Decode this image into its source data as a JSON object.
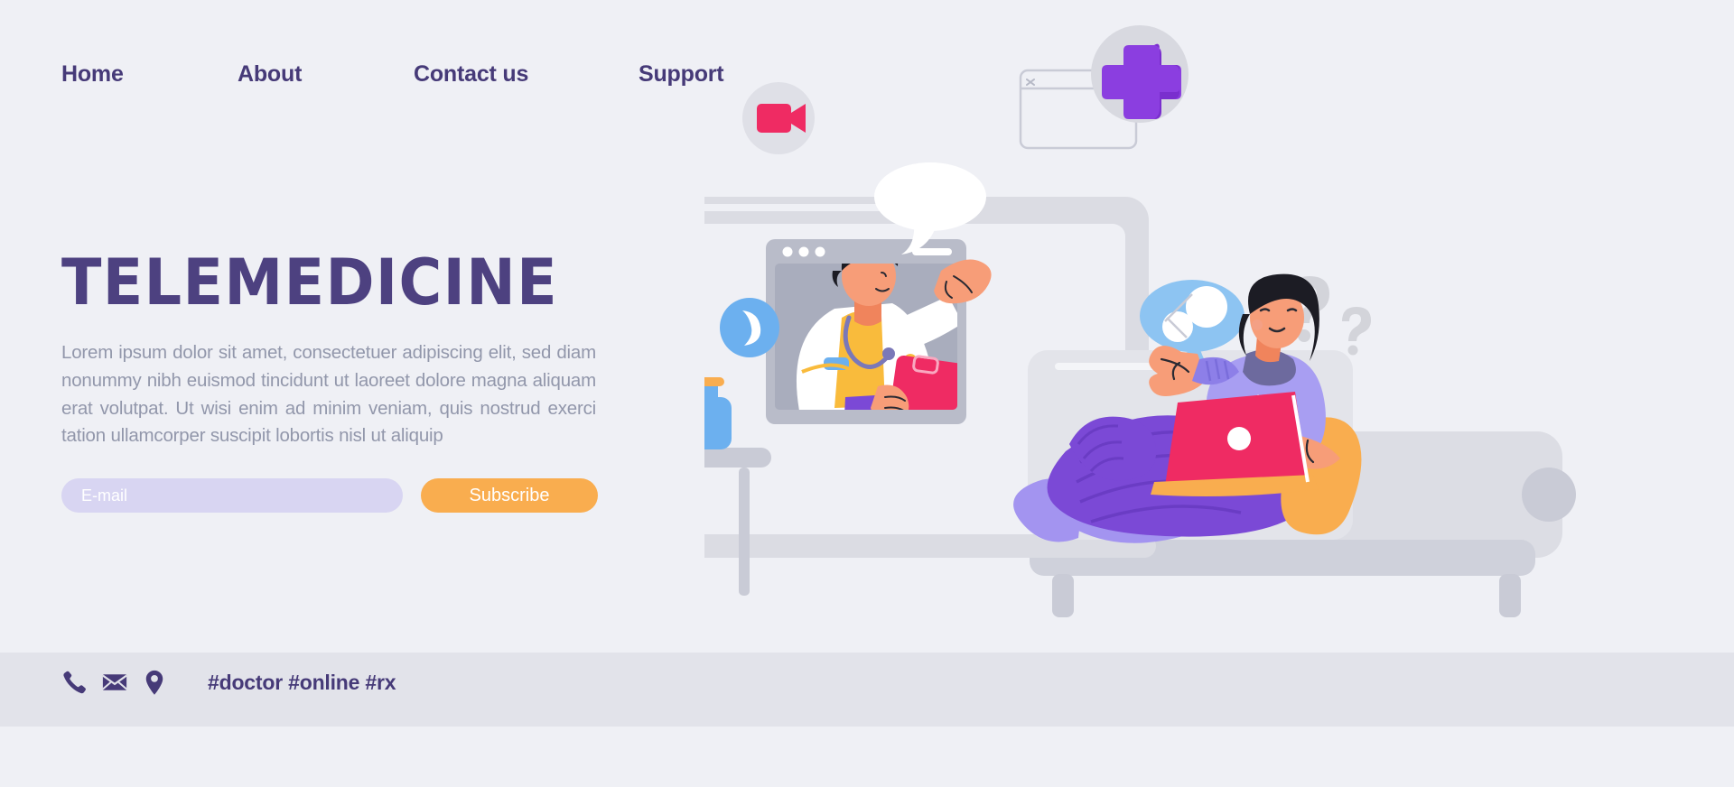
{
  "nav": {
    "items": [
      {
        "label": "Home",
        "name": "nav-item-home"
      },
      {
        "label": "About",
        "name": "nav-item-about"
      },
      {
        "label": "Contact us",
        "name": "nav-item-contact-us"
      },
      {
        "label": "Support",
        "name": "nav-item-support"
      }
    ]
  },
  "hero": {
    "title": "TELEMEDICINE",
    "description": "Lorem ipsum dolor sit amet, consectetuer adipiscing elit, sed diam nonummy nibh euismod tincidunt ut laoreet dolore magna aliquam erat volutpat. Ut wisi enim ad minim veniam, quis nostrud exerci tation ullamcorper suscipit lobortis nisl ut aliquip"
  },
  "form": {
    "email_placeholder": "E-mail",
    "email_value": "",
    "subscribe_label": "Subscribe"
  },
  "footer": {
    "icons": [
      {
        "name": "phone-icon",
        "label": "phone"
      },
      {
        "name": "envelope-icon",
        "label": "email"
      },
      {
        "name": "location-pin-icon",
        "label": "location"
      }
    ],
    "tags": "#doctor #online #rx"
  },
  "illustration": {
    "description": "Telemedicine scene: doctor on video call in monitor, patient with laptop on sofa",
    "badges": [
      {
        "name": "video-camera-badge-icon",
        "label": "video camera"
      },
      {
        "name": "medical-cross-badge-icon",
        "label": "medical cross"
      },
      {
        "name": "phone-call-badge-icon",
        "label": "phone call"
      },
      {
        "name": "browser-window-outline-icon",
        "label": "browser window"
      },
      {
        "name": "pill-speech-bubble-icon",
        "label": "pills speech bubble"
      },
      {
        "name": "question-marks-icon",
        "label": "question marks"
      },
      {
        "name": "doctor-speech-bubble-icon",
        "label": "speech bubble"
      }
    ]
  },
  "colors": {
    "background": "#eff0f5",
    "footer_background": "#e2e3ea",
    "brand_purple": "#4d4180",
    "nav_purple": "#463a78",
    "body_gray": "#9297ab",
    "input_lavender": "#d8d5f2",
    "accent_orange": "#f9ad4f",
    "accent_pink": "#ef2b63",
    "accent_blue": "#6cb0ef",
    "cross_purple": "#8b3ee0",
    "skin": "#f79d78",
    "device_gray": "#c9cbd6"
  }
}
